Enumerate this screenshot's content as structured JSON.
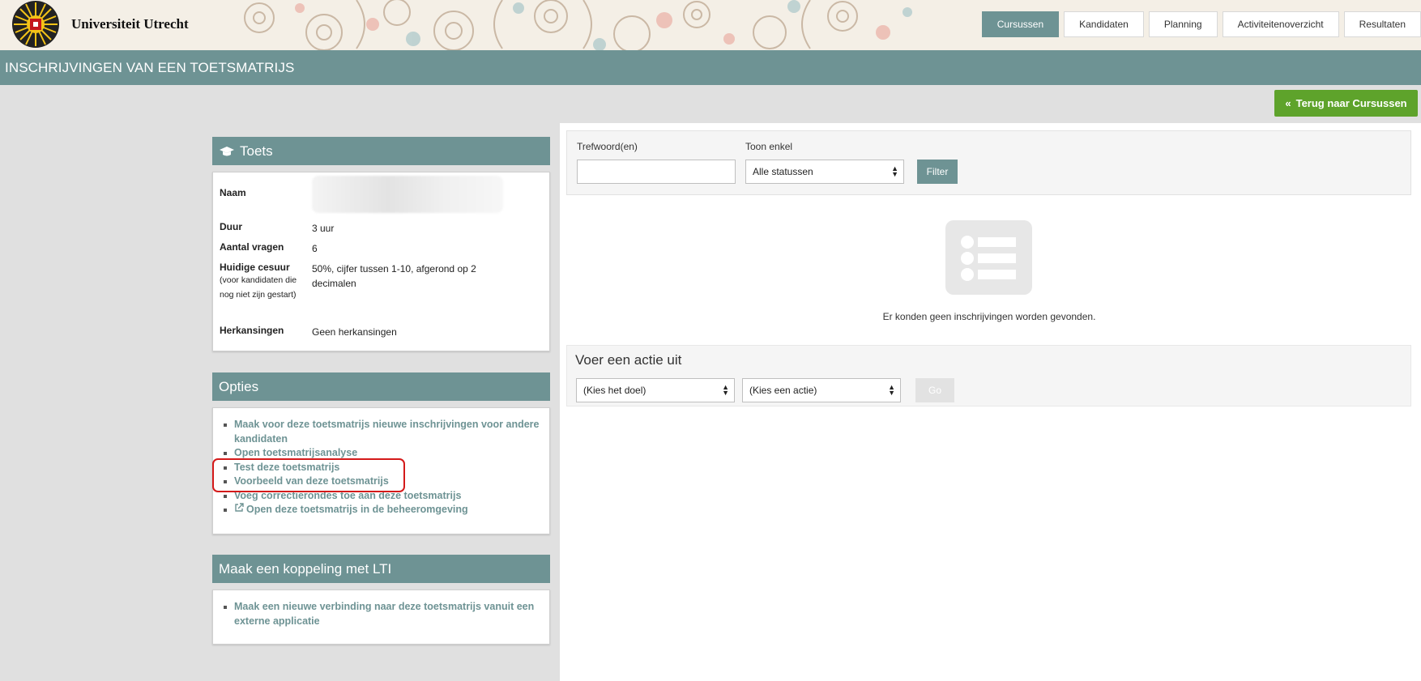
{
  "header": {
    "brand": "Universiteit Utrecht",
    "nav": [
      "Cursussen",
      "Kandidaten",
      "Planning",
      "Activiteitenoverzicht",
      "Resultaten"
    ],
    "active_nav": "Cursussen"
  },
  "page": {
    "title": "INSCHRIJVINGEN VAN EEN TOETSMATRIJS",
    "back_button": "Terug naar Cursussen"
  },
  "toets": {
    "heading": "Toets",
    "rows": {
      "naam_label": "Naam",
      "duur_label": "Duur",
      "duur_value": "3 uur",
      "vragen_label": "Aantal vragen",
      "vragen_value": "6",
      "cesuur_label": "Huidige cesuur",
      "cesuur_sub": "(voor kandidaten die nog niet zijn gestart)",
      "cesuur_value": "50%, cijfer tussen 1-10, afgerond op 2 decimalen",
      "herkansingen_label": "Herkansingen",
      "herkansingen_value": "Geen herkansingen"
    }
  },
  "opties": {
    "heading": "Opties",
    "items": [
      "Maak voor deze toetsmatrijs nieuwe inschrijvingen voor andere kandidaten",
      "Open toetsmatrijsanalyse",
      "Test deze toetsmatrijs",
      "Voorbeeld van deze toetsmatrijs",
      "Voeg correctierondes toe aan deze toetsmatrijs",
      "Open deze toetsmatrijs in de beheeromgeving"
    ]
  },
  "lti": {
    "heading": "Maak een koppeling met LTI",
    "items": [
      "Maak een nieuwe verbinding naar deze toetsmatrijs vanuit een externe applicatie"
    ]
  },
  "filter": {
    "keyword_label": "Trefwoord(en)",
    "keyword_value": "",
    "status_label": "Toon enkel",
    "status_selected": "Alle statussen",
    "filter_button": "Filter"
  },
  "empty_state": "Er konden geen inschrijvingen worden gevonden.",
  "action": {
    "title": "Voer een actie uit",
    "target_selected": "(Kies het doel)",
    "action_selected": "(Kies een actie)",
    "go_button": "Go"
  },
  "colors": {
    "teal": "#6e9394",
    "green": "#5ea32b",
    "highlight": "#d41a1a"
  }
}
